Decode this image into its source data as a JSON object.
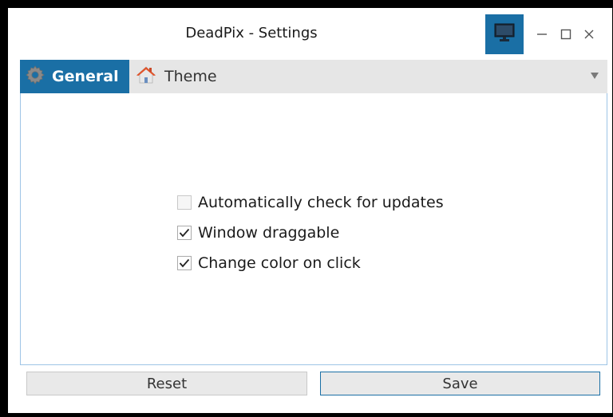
{
  "window": {
    "title": "DeadPix - Settings",
    "accent": "#1a6fa5",
    "controls": {
      "minimize": "minimize-icon",
      "maximize": "maximize-icon",
      "close": "close-icon"
    }
  },
  "tabs": [
    {
      "label": "General",
      "icon": "gear-icon",
      "active": true
    },
    {
      "label": "Theme",
      "icon": "house-icon",
      "active": false
    }
  ],
  "options": [
    {
      "label": "Automatically check for updates",
      "checked": false
    },
    {
      "label": "Window draggable",
      "checked": true
    },
    {
      "label": "Change color on click",
      "checked": true
    }
  ],
  "footer": {
    "reset_label": "Reset",
    "save_label": "Save"
  }
}
